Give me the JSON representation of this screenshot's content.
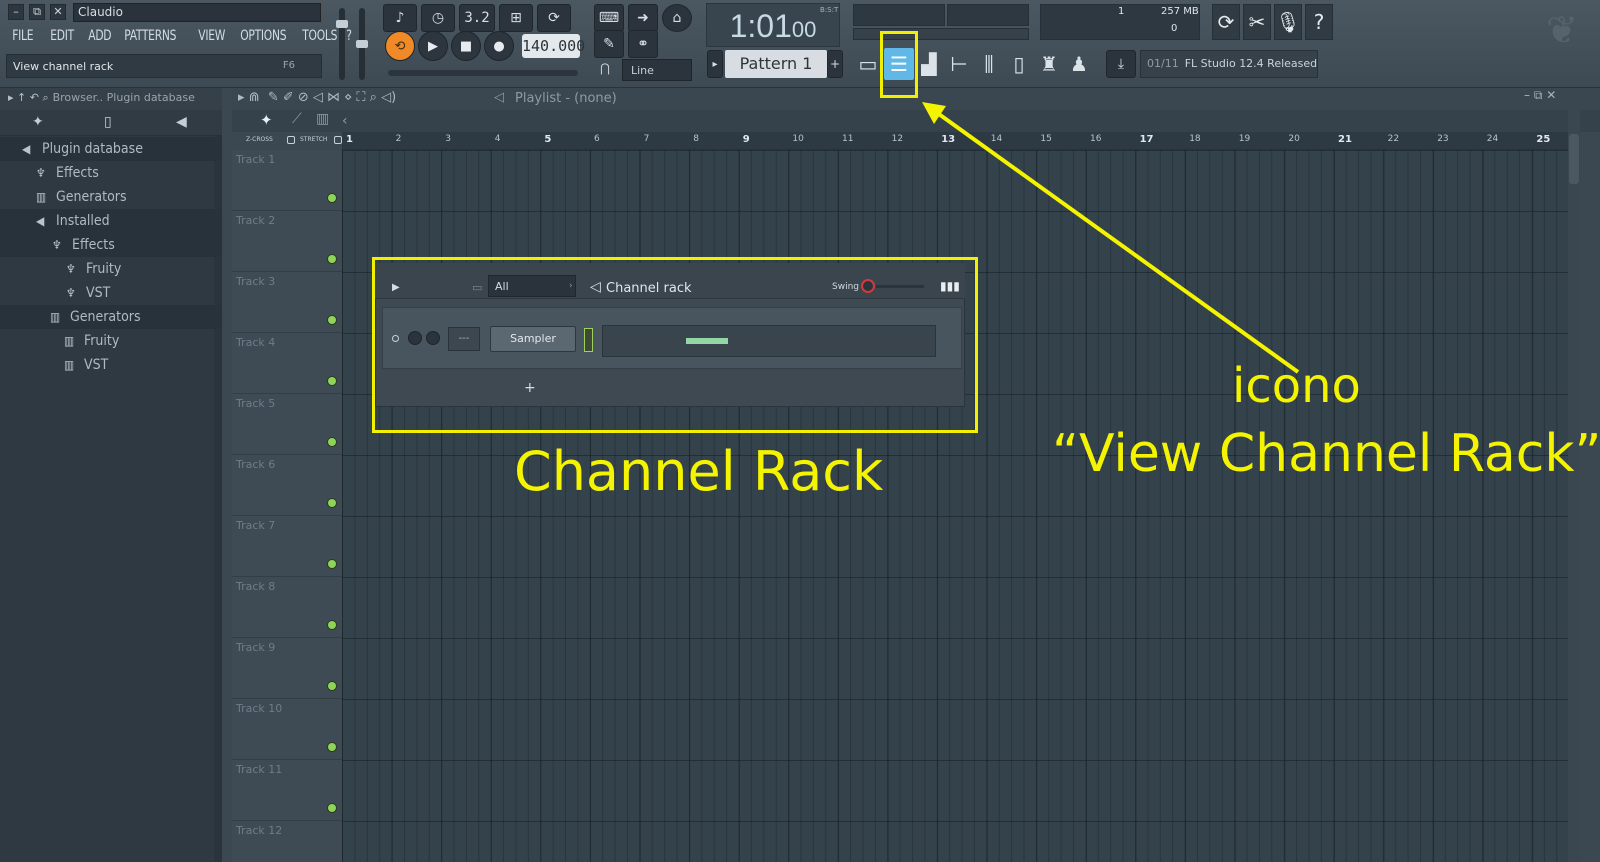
{
  "window": {
    "title": "Claudio",
    "btn_min": "–",
    "btn_max": "⧉",
    "btn_close": "✕"
  },
  "menu": [
    "FILE",
    "EDIT",
    "ADD",
    "PATTERNS",
    "VIEW",
    "OPTIONS",
    "TOOLS",
    "?"
  ],
  "hint": {
    "text": "View channel rack",
    "key": "F6"
  },
  "transport": {
    "bpm": "140.000",
    "time_main": "1:01",
    "time_sub": "00",
    "time_unit": "B:S:T",
    "pattern": "Pattern 1",
    "snap": "Line",
    "step_label": "3.2"
  },
  "cpu": {
    "voices": "1",
    "memory": "257 MB",
    "zero": "0"
  },
  "news": {
    "count": "01/11",
    "text": "FL Studio 12.4 Released"
  },
  "browser": {
    "header": "Browser.. Plugin database",
    "items": [
      {
        "label": "Plugin database",
        "icon": "speaker-icon"
      },
      {
        "label": "Effects",
        "icon": "mic-icon"
      },
      {
        "label": "Generators",
        "icon": "piano-icon"
      },
      {
        "label": "Installed",
        "icon": "speaker-icon"
      },
      {
        "label": "Effects",
        "icon": "mic-icon"
      },
      {
        "label": "Fruity",
        "icon": "mic-icon"
      },
      {
        "label": "VST",
        "icon": "mic-icon"
      },
      {
        "label": "Generators",
        "icon": "piano-icon"
      },
      {
        "label": "Fruity",
        "icon": "piano-icon"
      },
      {
        "label": "VST",
        "icon": "piano-icon"
      }
    ]
  },
  "playlist": {
    "title": "Playlist - (none)",
    "zcross": "Z-CROSS",
    "stretch": "STRETCH",
    "bars": [
      "1",
      "2",
      "3",
      "4",
      "5",
      "6",
      "7",
      "8",
      "9",
      "10",
      "11",
      "12",
      "13",
      "14",
      "15",
      "16",
      "17",
      "18",
      "19",
      "20",
      "21",
      "22",
      "23",
      "24",
      "25"
    ],
    "tracks": [
      "Track 1",
      "Track 2",
      "Track 3",
      "Track 4",
      "Track 5",
      "Track 6",
      "Track 7",
      "Track 8",
      "Track 9",
      "Track 10",
      "Track 11",
      "Track 12"
    ]
  },
  "channel_rack": {
    "filter": "All",
    "title": "Channel rack",
    "swing_label": "Swing",
    "channel": "Sampler",
    "channel_num": "---",
    "add": "+"
  },
  "annotations": {
    "rack_label": "Channel Rack",
    "icon_label_1": "icono",
    "icon_label_2": "“View Channel Rack”",
    "color": "#f4f400"
  }
}
